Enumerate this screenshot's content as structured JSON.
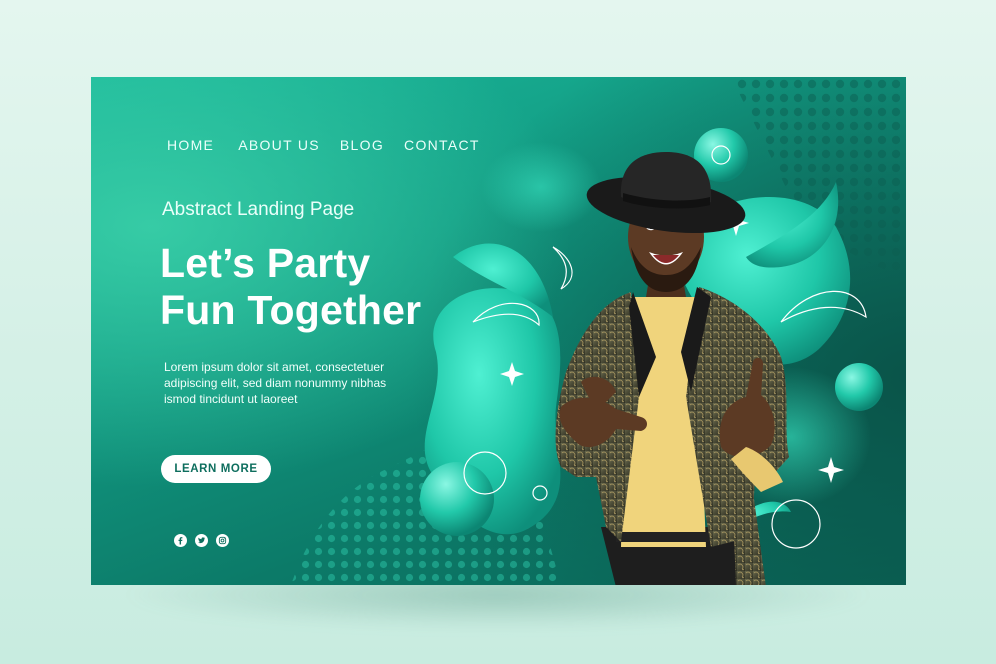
{
  "nav": {
    "items": [
      {
        "label": "HOME"
      },
      {
        "label": "ABOUT US"
      },
      {
        "label": "BLOG"
      },
      {
        "label": "CONTACT"
      }
    ]
  },
  "hero": {
    "eyebrow": "Abstract Landing Page",
    "headline_line1": "Let’s Party",
    "headline_line2": "Fun Together",
    "body_line1": "Lorem ipsum dolor sit amet, consectetuer",
    "body_line2": "adipiscing elit, sed diam nonummy nibhas",
    "body_line3": "ismod tincidunt ut laoreet",
    "cta_label": "LEARN MORE"
  },
  "social": {
    "icons": [
      "facebook-icon",
      "twitter-icon",
      "instagram-icon"
    ]
  },
  "colors": {
    "page_background": "#dcf3ea",
    "card_gradient_start": "#1bb89a",
    "card_gradient_end": "#0a6658",
    "blob": "#2fd4b4",
    "text": "#ffffff",
    "button_text": "#0e6e5e"
  }
}
